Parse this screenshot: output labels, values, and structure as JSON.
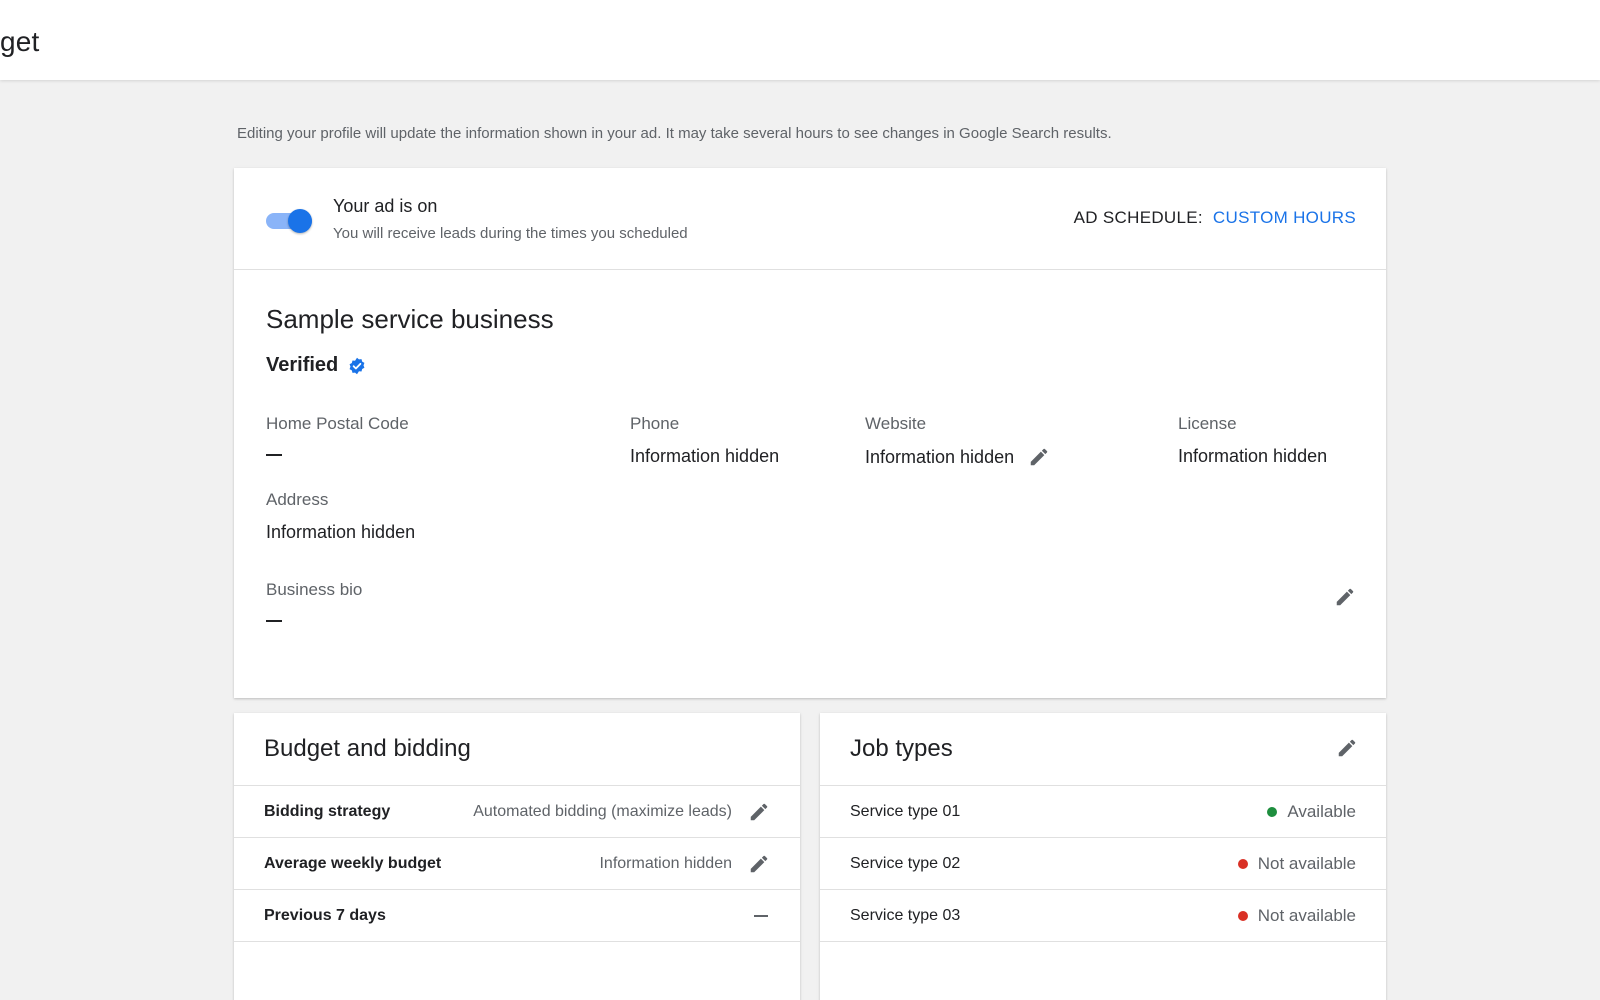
{
  "header": {
    "title": "get"
  },
  "notice": "Editing your profile will update the information shown in your ad. It may take several hours to see changes in Google Search results.",
  "ad_status": {
    "toggle_on": true,
    "title": "Your ad is on",
    "subtitle": "You will receive leads during the times you scheduled",
    "schedule_label": "AD SCHEDULE:",
    "schedule_value": "CUSTOM HOURS"
  },
  "profile": {
    "business_name": "Sample service business",
    "verified_label": "Verified",
    "fields": {
      "postal_code": {
        "label": "Home Postal Code",
        "value": "—"
      },
      "phone": {
        "label": "Phone",
        "value": "Information hidden"
      },
      "website": {
        "label": "Website",
        "value": "Information hidden"
      },
      "license": {
        "label": "License",
        "value": "Information hidden"
      },
      "address": {
        "label": "Address",
        "value": "Information hidden"
      },
      "bio": {
        "label": "Business bio",
        "value": "—"
      }
    }
  },
  "budget": {
    "title": "Budget and bidding",
    "rows": [
      {
        "label": "Bidding strategy",
        "value": "Automated bidding (maximize leads)"
      },
      {
        "label": "Average weekly budget",
        "value": "Information hidden"
      },
      {
        "label": "Previous 7 days",
        "value": "—"
      }
    ]
  },
  "jobs": {
    "title": "Job types",
    "rows": [
      {
        "label": "Service type 01",
        "status": "Available",
        "color": "#1e8e3e"
      },
      {
        "label": "Service type 02",
        "status": "Not available",
        "color": "#d93025"
      },
      {
        "label": "Service type 03",
        "status": "Not available",
        "color": "#d93025"
      }
    ]
  },
  "colors": {
    "accent": "#1a73e8",
    "available": "#1e8e3e",
    "unavailable": "#d93025"
  },
  "icons": {
    "edit": "pencil-icon",
    "verified": "verified-badge-icon"
  }
}
